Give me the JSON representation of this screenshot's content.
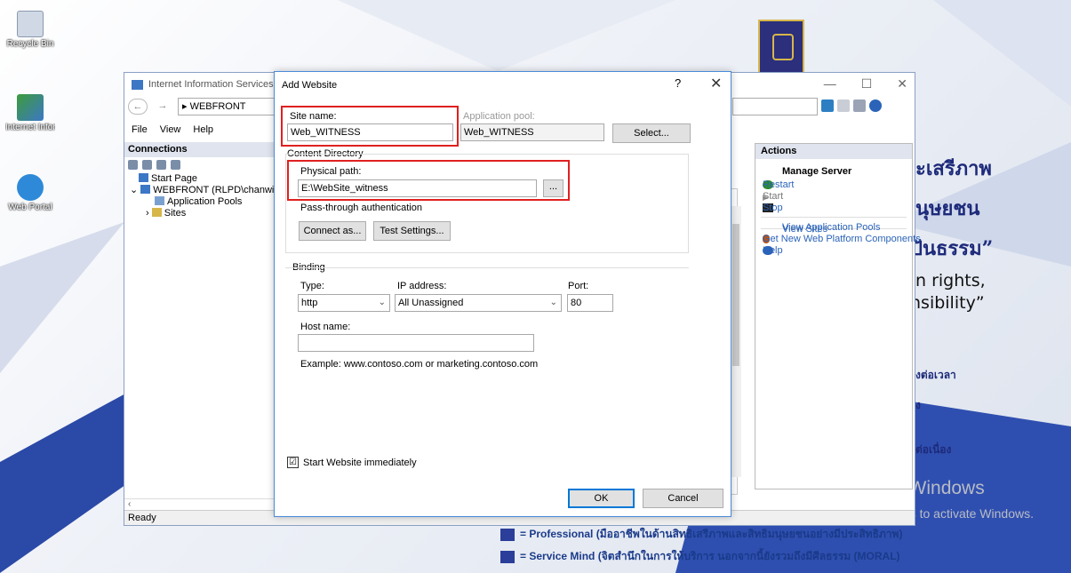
{
  "desktop": {
    "icons": [
      {
        "label": "Recycle Bin"
      },
      {
        "label": "Internet Informatio..."
      },
      {
        "label": "Web Portal"
      }
    ],
    "thai_text": [
      "ะเสรีภาพ",
      "นุษยชน",
      "ปันธรรม”"
    ],
    "eng_text": [
      "n rights,",
      "nsibility”"
    ],
    "thai_small": [
      "งต่อเวลา",
      "ง",
      "ต่อเนื่อง"
    ],
    "bottom_lines": [
      "= Professional (มืออาชีพในด้านสิทธิเสรีภาพและสิทธิมนุษยชนอย่างมีประสิทธิภาพ)",
      "= Service Mind (จิตสำนึกในการให้บริการ นอกจากนี้ยังรวมถึงมีศีลธรรม (MORAL)"
    ],
    "activate_title": "Activate Windows",
    "activate_sub": "Go to Settings to activate Windows."
  },
  "iis": {
    "title": "Internet Information Services (II",
    "address": "WEBFRONT",
    "menu": [
      "File",
      "View",
      "Help"
    ],
    "connections_header": "Connections",
    "tree": [
      "Start Page",
      "WEBFRONT (RLPD\\chanwit.",
      "Application Pools",
      "Sites"
    ],
    "status": "Ready",
    "actions_header": "Actions",
    "manage_server": "Manage Server",
    "actions": [
      {
        "label": "Restart",
        "enabled": true,
        "color": "#2e8b2e"
      },
      {
        "label": "Start",
        "enabled": false,
        "color": "#999999"
      },
      {
        "label": "Stop",
        "enabled": true,
        "color": "#222222"
      },
      {
        "label": "View Application Pools",
        "enabled": true,
        "color": ""
      },
      {
        "label": "View Sites",
        "enabled": true,
        "color": ""
      },
      {
        "label": "Get New Web Platform Components",
        "enabled": true,
        "color": "#b3541e"
      },
      {
        "label": "Help",
        "enabled": true,
        "color": "#2a63b8"
      }
    ]
  },
  "dialog": {
    "title": "Add Website",
    "help_glyph": "?",
    "close_glyph": "✕",
    "site_name_label": "Site name:",
    "site_name_value": "Web_WITNESS",
    "app_pool_label": "Application pool:",
    "app_pool_value": "Web_WITNESS",
    "select_button": "Select...",
    "content_dir_label": "Content Directory",
    "physical_path_label": "Physical path:",
    "physical_path_value": "E:\\WebSite_witness",
    "browse_button": "...",
    "passthrough_label": "Pass-through authentication",
    "connect_as_button": "Connect as...",
    "test_settings_button": "Test Settings...",
    "binding_label": "Binding",
    "type_label": "Type:",
    "type_value": "http",
    "ip_label": "IP address:",
    "ip_value": "All Unassigned",
    "port_label": "Port:",
    "port_value": "80",
    "host_label": "Host name:",
    "host_value": "",
    "example_text": "Example: www.contoso.com or marketing.contoso.com",
    "start_immediately_label": "Start Website immediately",
    "start_immediately_checked": "☑",
    "ok_button": "OK",
    "cancel_button": "Cancel"
  }
}
